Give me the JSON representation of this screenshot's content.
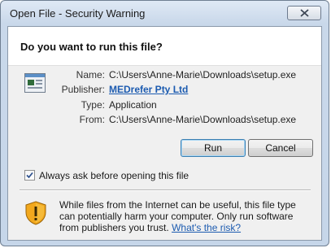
{
  "window": {
    "title": "Open File - Security Warning",
    "close_icon": "close-icon"
  },
  "dialog": {
    "question": "Do you want to run this file?",
    "file_icon": "application-window-icon",
    "fields": {
      "name_label": "Name:",
      "name_value": "C:\\Users\\Anne-Marie\\Downloads\\setup.exe",
      "publisher_label": "Publisher:",
      "publisher_value": "MEDrefer Pty Ltd",
      "type_label": "Type:",
      "type_value": "Application",
      "from_label": "From:",
      "from_value": "C:\\Users\\Anne-Marie\\Downloads\\setup.exe"
    },
    "buttons": {
      "run": "Run",
      "cancel": "Cancel"
    },
    "checkbox": {
      "label": "Always ask before opening this file",
      "checked": true
    },
    "warning": {
      "icon": "shield-warning-icon",
      "text": "While files from the Internet can be useful, this file type can potentially harm your computer. Only run software from publishers you trust.",
      "link": "What's the risk?"
    }
  },
  "colors": {
    "link": "#1c5bb0",
    "frame": "#c9d8ea",
    "shield": "#f2a81d"
  }
}
